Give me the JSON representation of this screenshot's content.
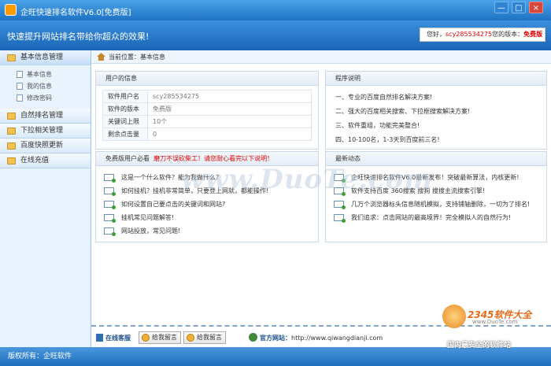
{
  "window": {
    "title": "企旺快速排名软件V6.0[免费版]",
    "controls": [
      "—",
      "□",
      "×"
    ]
  },
  "header": {
    "slogan": "快速提升网站排名带给你超众的效果!",
    "greeting": "您好，",
    "username": "scy285534275",
    "version_label": "您的版本：",
    "version_value": "免费版"
  },
  "sidebar": {
    "sections": [
      {
        "label": "基本信息管理",
        "items": [
          "基本信息",
          "我的信息",
          "修改密码"
        ]
      },
      {
        "label": "自然排名管理"
      },
      {
        "label": "下拉相关管理"
      },
      {
        "label": "百度快照更新"
      },
      {
        "label": "在线充值"
      }
    ]
  },
  "breadcrumb": "当前位置：基本信息",
  "user_info": {
    "title": "用户的信息",
    "rows": [
      {
        "key": "软件用户名",
        "value": "scy285534275"
      },
      {
        "key": "软件的版本",
        "value": "免费版"
      },
      {
        "key": "关键词上限",
        "value": "10个"
      },
      {
        "key": "剩余点击量",
        "value": "0"
      }
    ]
  },
  "program": {
    "title": "程序说明",
    "items": [
      "一、专业的百度自然排名解决方案!",
      "二、强大的百度相关搜索、下拉框搜索解决方案!",
      "三、软件重组，功能完美整合!",
      "四、10-100名，1-3天到百度前三名!"
    ]
  },
  "faq": {
    "title_prefix": "免费版用户必看",
    "title_hot": "磨刀不误砍柴工！请您耐心看完以下说明！",
    "items": [
      "这是一个什么软件？能为我做什么？",
      "如何挂机？挂机非常简单，只要登上网就，都能操作!",
      "如何设置自己要点击的关键词和网站?",
      "挂机常见问题解答!",
      "网站投放，常见问题!"
    ]
  },
  "news": {
    "title": "最新动态",
    "items": [
      "企旺快速排名软件V6.0最新发布！突破最新算法，内核更新!",
      "软件支持百度 360搜索 搜狗 搜搜主流搜索引擎!",
      "几万个浏览器标头信息随机模拟，支持铺轴删除，一切为了排名!",
      "我们追求：点击网站的最高境界！完全模拟人的自然行为!"
    ]
  },
  "footer": {
    "cs_label": "在线客服",
    "msg_button": "给我留言",
    "site_label": "官方网站：",
    "site_url": "http://www.qiwangdianji.com"
  },
  "status": "版权所有：企旺软件",
  "overlay": {
    "watermark": "www.DuoTe.com",
    "badge_title": "2345软件大全",
    "badge_url": "www.DuoTe.com",
    "badge_slogan": "国内最安全的软件站"
  }
}
